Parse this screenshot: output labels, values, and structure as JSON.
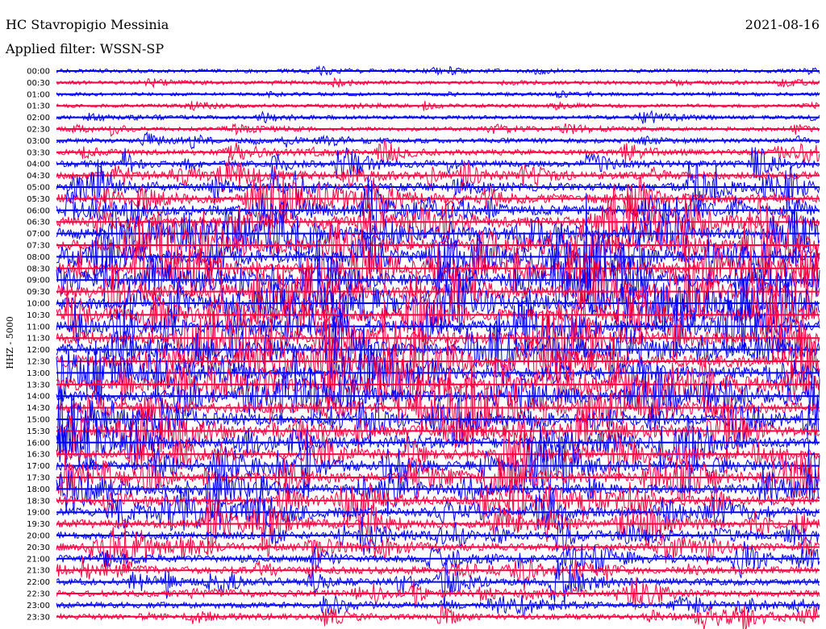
{
  "chart_data": {
    "type": "line",
    "title": "HC Stavropigio Messinia",
    "subtitle": "Applied filter: WSSN-SP",
    "date": "2021-08-16",
    "ylabel": "HHZ - 5000",
    "xlabel": "",
    "row_labels": [
      "00:00",
      "00:30",
      "01:00",
      "01:30",
      "02:00",
      "02:30",
      "03:00",
      "03:30",
      "04:00",
      "04:30",
      "05:00",
      "05:30",
      "06:00",
      "06:30",
      "07:00",
      "07:30",
      "08:00",
      "08:30",
      "09:00",
      "09:30",
      "10:00",
      "10:30",
      "11:00",
      "11:30",
      "12:00",
      "12:30",
      "13:00",
      "13:30",
      "14:00",
      "14:30",
      "15:00",
      "15:30",
      "16:00",
      "16:30",
      "17:00",
      "17:30",
      "18:00",
      "18:30",
      "19:00",
      "19:30",
      "20:00",
      "20:30",
      "21:00",
      "21:30",
      "22:00",
      "22:30",
      "23:00",
      "23:30"
    ],
    "row_colors": [
      "#0000ff",
      "#ff0040"
    ],
    "minutes_per_row": 30,
    "grid": false,
    "legend": "none",
    "activity_profile": [
      0.08,
      0.07,
      0.06,
      0.07,
      0.08,
      0.1,
      0.14,
      0.2,
      0.26,
      0.32,
      0.38,
      0.42,
      0.46,
      0.5,
      0.54,
      0.56,
      0.58,
      0.6,
      0.62,
      0.62,
      0.62,
      0.6,
      0.6,
      0.6,
      0.58,
      0.58,
      0.56,
      0.56,
      0.55,
      0.54,
      0.52,
      0.5,
      0.48,
      0.46,
      0.44,
      0.44,
      0.42,
      0.4,
      0.38,
      0.36,
      0.34,
      0.32,
      0.3,
      0.3,
      0.28,
      0.26,
      0.22,
      0.2
    ]
  }
}
